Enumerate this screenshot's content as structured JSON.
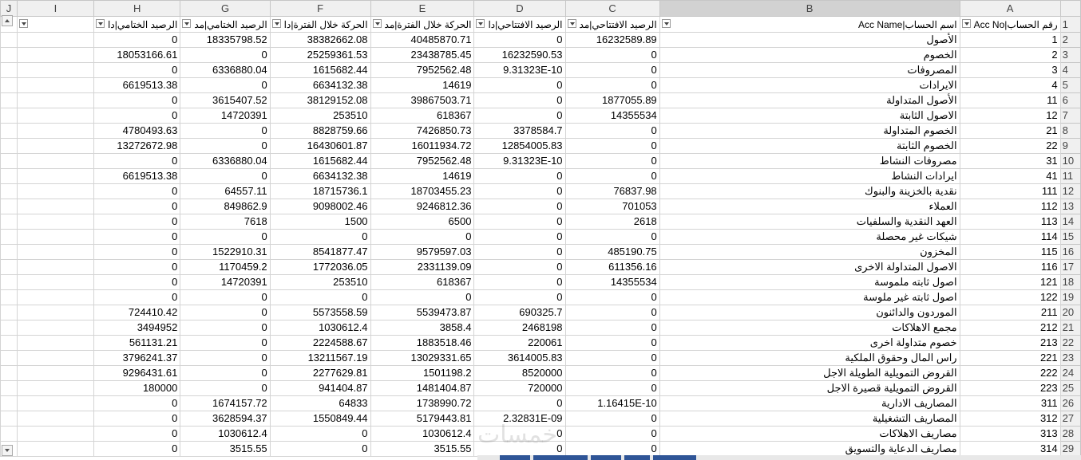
{
  "columns": [
    "J",
    "I",
    "H",
    "G",
    "F",
    "E",
    "D",
    "C",
    "B",
    "A"
  ],
  "selected_column": "B",
  "header_row": {
    "row_number": "1",
    "acc_no": "رقم الحساب|Acc No",
    "acc_name": "اسم الحساب|Acc Name",
    "c": "الرصيد الافتتاحي|مد",
    "d": "الرصيد الافتتاحي|دا",
    "e": "الحركة خلال الفترة|مد",
    "f": "الحركة خلال الفترة|دا",
    "g": "الرصيد الختامي|مد",
    "h": "الرصيد الختامي|دا"
  },
  "rows": [
    {
      "r": "2",
      "a": "1",
      "b": "الأصول",
      "c": "16232589.89",
      "d": "0",
      "e": "40485870.71",
      "f": "38382662.08",
      "g": "18335798.52",
      "h": "0"
    },
    {
      "r": "3",
      "a": "2",
      "b": "الخصوم",
      "c": "0",
      "d": "16232590.53",
      "e": "23438785.45",
      "f": "25259361.53",
      "g": "0",
      "h": "18053166.61"
    },
    {
      "r": "4",
      "a": "3",
      "b": "المصروفات",
      "c": "0",
      "d": "9.31323E-10",
      "e": "7952562.48",
      "f": "1615682.44",
      "g": "6336880.04",
      "h": "0"
    },
    {
      "r": "5",
      "a": "4",
      "b": "الايرادات",
      "c": "0",
      "d": "0",
      "e": "14619",
      "f": "6634132.38",
      "g": "0",
      "h": "6619513.38"
    },
    {
      "r": "6",
      "a": "11",
      "b": "الأصول المتداولة",
      "c": "1877055.89",
      "d": "0",
      "e": "39867503.71",
      "f": "38129152.08",
      "g": "3615407.52",
      "h": "0"
    },
    {
      "r": "7",
      "a": "12",
      "b": "الاصول الثابتة",
      "c": "14355534",
      "d": "0",
      "e": "618367",
      "f": "253510",
      "g": "14720391",
      "h": "0"
    },
    {
      "r": "8",
      "a": "21",
      "b": "الخصوم المتداولة",
      "c": "0",
      "d": "3378584.7",
      "e": "7426850.73",
      "f": "8828759.66",
      "g": "0",
      "h": "4780493.63"
    },
    {
      "r": "9",
      "a": "22",
      "b": "الخصوم الثابتة",
      "c": "0",
      "d": "12854005.83",
      "e": "16011934.72",
      "f": "16430601.87",
      "g": "0",
      "h": "13272672.98"
    },
    {
      "r": "10",
      "a": "31",
      "b": "مصروفات النشاط",
      "c": "0",
      "d": "9.31323E-10",
      "e": "7952562.48",
      "f": "1615682.44",
      "g": "6336880.04",
      "h": "0"
    },
    {
      "r": "11",
      "a": "41",
      "b": "ايرادات النشاط",
      "c": "0",
      "d": "0",
      "e": "14619",
      "f": "6634132.38",
      "g": "0",
      "h": "6619513.38"
    },
    {
      "r": "12",
      "a": "111",
      "b": "نقدية بالخزينة والبنوك",
      "c": "76837.98",
      "d": "0",
      "e": "18703455.23",
      "f": "18715736.1",
      "g": "64557.11",
      "h": "0"
    },
    {
      "r": "13",
      "a": "112",
      "b": "العملاء",
      "c": "701053",
      "d": "0",
      "e": "9246812.36",
      "f": "9098002.46",
      "g": "849862.9",
      "h": "0"
    },
    {
      "r": "14",
      "a": "113",
      "b": "العهد النقدية والسلفيات",
      "c": "2618",
      "d": "0",
      "e": "6500",
      "f": "1500",
      "g": "7618",
      "h": "0"
    },
    {
      "r": "15",
      "a": "114",
      "b": "شيكات غير محصلة",
      "c": "0",
      "d": "0",
      "e": "0",
      "f": "0",
      "g": "0",
      "h": "0"
    },
    {
      "r": "16",
      "a": "115",
      "b": "المخزون",
      "c": "485190.75",
      "d": "0",
      "e": "9579597.03",
      "f": "8541877.47",
      "g": "1522910.31",
      "h": "0"
    },
    {
      "r": "17",
      "a": "116",
      "b": "الاصول المتداولة الاخرى",
      "c": "611356.16",
      "d": "0",
      "e": "2331139.09",
      "f": "1772036.05",
      "g": "1170459.2",
      "h": "0"
    },
    {
      "r": "18",
      "a": "121",
      "b": "اصول ثابته ملموسة",
      "c": "14355534",
      "d": "0",
      "e": "618367",
      "f": "253510",
      "g": "14720391",
      "h": "0"
    },
    {
      "r": "19",
      "a": "122",
      "b": "اصول ثابته غير ملوسة",
      "c": "0",
      "d": "0",
      "e": "0",
      "f": "0",
      "g": "0",
      "h": "0"
    },
    {
      "r": "20",
      "a": "211",
      "b": "الموردون والدائنون",
      "c": "0",
      "d": "690325.7",
      "e": "5539473.87",
      "f": "5573558.59",
      "g": "0",
      "h": "724410.42"
    },
    {
      "r": "21",
      "a": "212",
      "b": "مجمع الاهلاكات",
      "c": "0",
      "d": "2468198",
      "e": "3858.4",
      "f": "1030612.4",
      "g": "0",
      "h": "3494952"
    },
    {
      "r": "22",
      "a": "213",
      "b": "خصوم متداولة اخرى",
      "c": "0",
      "d": "220061",
      "e": "1883518.46",
      "f": "2224588.67",
      "g": "0",
      "h": "561131.21"
    },
    {
      "r": "23",
      "a": "221",
      "b": "راس المال وحقوق الملكية",
      "c": "0",
      "d": "3614005.83",
      "e": "13029331.65",
      "f": "13211567.19",
      "g": "0",
      "h": "3796241.37"
    },
    {
      "r": "24",
      "a": "222",
      "b": "القروض التمويلية الطويلة الاجل",
      "c": "0",
      "d": "8520000",
      "e": "1501198.2",
      "f": "2277629.81",
      "g": "0",
      "h": "9296431.61"
    },
    {
      "r": "25",
      "a": "223",
      "b": "القروض التمويلية قصيرة الاجل",
      "c": "0",
      "d": "720000",
      "e": "1481404.87",
      "f": "941404.87",
      "g": "0",
      "h": "180000"
    },
    {
      "r": "26",
      "a": "311",
      "b": "المصاريف الادارية",
      "c": "1.16415E-10",
      "d": "0",
      "e": "1738990.72",
      "f": "64833",
      "g": "1674157.72",
      "h": "0"
    },
    {
      "r": "27",
      "a": "312",
      "b": "المصاريف التشغيلية",
      "c": "0",
      "d": "2.32831E-09",
      "e": "5179443.81",
      "f": "1550849.44",
      "g": "3628594.37",
      "h": "0"
    },
    {
      "r": "28",
      "a": "313",
      "b": "مصاريف الاهلاكات",
      "c": "0",
      "d": "0",
      "e": "1030612.4",
      "f": "0",
      "g": "1030612.4",
      "h": "0"
    },
    {
      "r": "29",
      "a": "314",
      "b": "مصاريف الدعاية والتسويق",
      "c": "0",
      "d": "0",
      "e": "3515.55",
      "f": "0",
      "g": "3515.55",
      "h": "0"
    }
  ],
  "watermark": "خمسات",
  "colors": {
    "header_bg": "#f0f0f0",
    "selected_header": "#d2d2d2",
    "grid": "#d4d4d4",
    "tab": "#2f5597"
  }
}
